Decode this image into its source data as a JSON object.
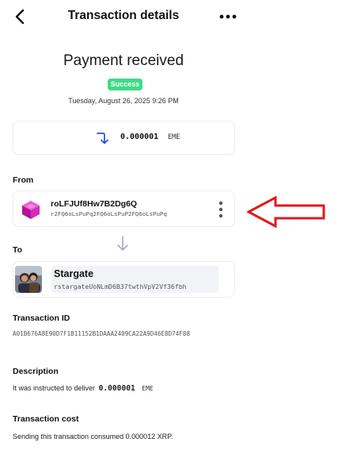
{
  "header": {
    "title": "Transaction details",
    "back_icon": "chevron-left-icon",
    "more_icon": "more-horizontal-icon"
  },
  "status": {
    "headline": "Payment received",
    "badge": "Success",
    "badge_color": "#3ddc84",
    "datetime": "Tuesday, August 26, 2025 9:26 PM"
  },
  "amount": {
    "value": "0.000001",
    "unit": "EME",
    "direction_icon": "arrow-down-return-icon",
    "accent_color": "#2d56d6"
  },
  "from": {
    "label": "From",
    "name": "roLFJUf8Hw7B2Dg6Q",
    "address": "r2FQ6oLsPuPq2FQ6oLsPuP2FQ6oLsPuPq",
    "avatar_icon": "magenta-cube-icon",
    "menu_icon": "more-vertical-icon"
  },
  "to": {
    "label": "To",
    "name": "Stargate",
    "address": "rstargateUoNLmD6B37twthVpV2Vf36fbh",
    "avatar_icon": "profile-photo"
  },
  "transaction_id": {
    "label": "Transaction ID",
    "value": "A01B676A8E90D7F1B11152B1DAAA2409CA22A9D46E8D74F88"
  },
  "description": {
    "label": "Description",
    "prefix": "It was instructed to deliver",
    "amount": "0.000001",
    "unit": "EME"
  },
  "cost": {
    "label": "Transaction cost",
    "text": "Sending this transaction consumed 0.000012 XRP."
  },
  "annotation": {
    "icon": "red-arrow-annotation",
    "color": "#e0191e"
  }
}
